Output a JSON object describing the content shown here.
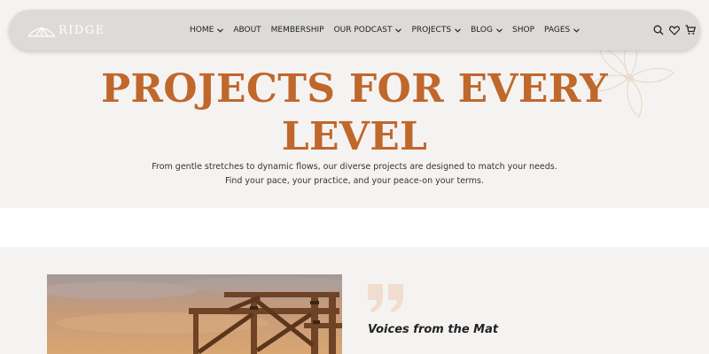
{
  "header": {
    "logo_text": "RIDGE",
    "menu": [
      {
        "label": "HOME",
        "dropdown": true
      },
      {
        "label": "ABOUT",
        "dropdown": false
      },
      {
        "label": "MEMBERSHIP",
        "dropdown": false
      },
      {
        "label": "OUR PODCAST",
        "dropdown": true
      },
      {
        "label": "PROJECTS",
        "dropdown": true
      },
      {
        "label": "BLOG",
        "dropdown": true
      },
      {
        "label": "SHOP",
        "dropdown": false
      },
      {
        "label": "PAGES",
        "dropdown": true
      }
    ],
    "icons": [
      "search-icon",
      "heart-icon",
      "cart-icon"
    ]
  },
  "hero": {
    "title_line1": "PROJECTS FOR EVERY",
    "title_line2": "LEVEL",
    "subtitle_line1": "From gentle stretches to dynamic flows, our diverse projects are designed to match your needs.",
    "subtitle_line2": "Find your pace, your practice, and your peace-on your terms."
  },
  "testimonial": {
    "heading": "Voices from the Mat"
  },
  "colors": {
    "accent": "#c0672c",
    "nav_bg": "#dcdbd9",
    "page_bg": "#f5f3f1"
  }
}
